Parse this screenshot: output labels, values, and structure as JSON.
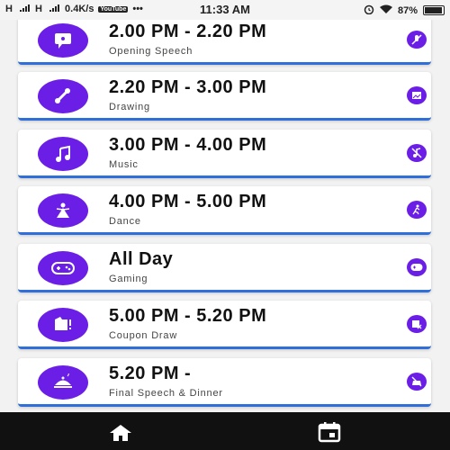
{
  "status_bar": {
    "signal_1": "H",
    "signal_2": "H",
    "net_speed": "0.4K/s",
    "yt_badge": "YouTube",
    "dots": "•••",
    "time": "11:33 AM",
    "battery": "87%"
  },
  "schedule": [
    {
      "time": "2.00 PM - 2.20 PM",
      "label": "Opening Speech",
      "icon": "speech-icon",
      "side_icon": "mic-off-icon"
    },
    {
      "time": "2.20 PM - 3.00 PM",
      "label": "Drawing",
      "icon": "brush-icon",
      "side_icon": "image-icon"
    },
    {
      "time": "3.00 PM - 4.00 PM",
      "label": "Music",
      "icon": "music-note-icon",
      "side_icon": "music-off-icon"
    },
    {
      "time": "4.00 PM - 5.00 PM",
      "label": "Dance",
      "icon": "dancer-icon",
      "side_icon": "running-person-icon"
    },
    {
      "time": "All Day",
      "label": "Gaming",
      "icon": "gamepad-icon",
      "side_icon": "gamepad-icon"
    },
    {
      "time": "5.00 PM - 5.20 PM",
      "label": "Coupon Draw",
      "icon": "coupon-icon",
      "side_icon": "coupon-icon"
    },
    {
      "time": "5.20 PM -",
      "label": "Final Speech & Dinner",
      "icon": "dinner-icon",
      "side_icon": "dinner-icon"
    }
  ],
  "nav": {
    "home_icon": "home-icon",
    "calendar_icon": "calendar-icon"
  },
  "colors": {
    "accent": "#6a1ee6",
    "card_underline": "#2e6fdc",
    "nav_bg": "#111111"
  }
}
